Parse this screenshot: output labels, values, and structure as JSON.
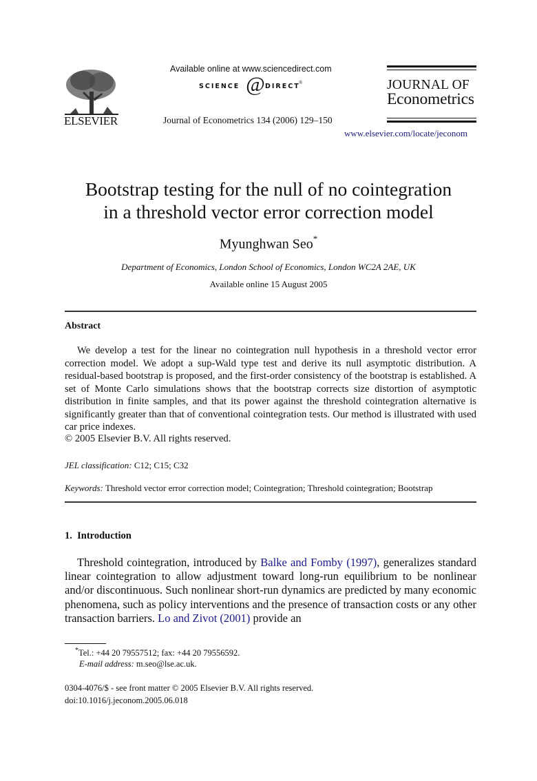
{
  "header": {
    "publisher_logo_text": "ELSEVIER",
    "available_online_text": "Available online at www.sciencedirect.com",
    "sciencedirect_left": "SCIENCE",
    "sciencedirect_at": "@",
    "sciencedirect_right": "DIRECT",
    "sciencedirect_mark": "®",
    "journal_reference": "Journal of Econometrics 134 (2006) 129–150",
    "journal_title_line1": "JOURNAL OF",
    "journal_title_line2": "Econometrics",
    "journal_url": "www.elsevier.com/locate/jeconom"
  },
  "article": {
    "title_line1": "Bootstrap testing for the null of no cointegration",
    "title_line2": "in a threshold vector error correction model",
    "author": "Myunghwan Seo",
    "author_mark": "*",
    "affiliation": "Department of Economics, London School of Economics, London WC2A 2AE, UK",
    "available_online": "Available online 15 August 2005"
  },
  "abstract": {
    "heading": "Abstract",
    "text": "We develop a test for the linear no cointegration null hypothesis in a threshold vector error correction model. We adopt a sup-Wald type test and derive its null asymptotic distribution. A residual-based bootstrap is proposed, and the first-order consistency of the bootstrap is established. A set of Monte Carlo simulations shows that the bootstrap corrects size distortion of asymptotic distribution in finite samples, and that its power against the threshold cointegration alternative is significantly greater than that of conventional cointegration tests. Our method is illustrated with used car price indexes.",
    "copyright": "© 2005 Elsevier B.V. All rights reserved.",
    "jel_label": "JEL classification:",
    "jel_codes": "C12; C15; C32",
    "keywords_label": "Keywords:",
    "keywords": "Threshold vector error correction model; Cointegration; Threshold cointegration; Bootstrap"
  },
  "introduction": {
    "heading": "1.  Introduction",
    "text_part1": "Threshold cointegration, introduced by ",
    "citation1": "Balke and Fomby (1997)",
    "text_part2": ", generalizes standard linear cointegration to allow adjustment toward long-run equilibrium to be nonlinear and/or discontinuous. Such nonlinear short-run dynamics are predicted by many economic phenomena, such as policy interventions and the presence of transaction costs or any other transaction barriers. ",
    "citation2": "Lo and Zivot (2001)",
    "text_part3": " provide an"
  },
  "footnotes": {
    "mark": "*",
    "contact": "Tel.: +44 20 79557512; fax: +44 20 79556592.",
    "email_label": "E-mail address:",
    "email": "m.seo@lse.ac.uk."
  },
  "front_matter": {
    "line1": "0304-4076/$ - see front matter © 2005 Elsevier B.V. All rights reserved.",
    "doi": "doi:10.1016/j.jeconom.2005.06.018"
  },
  "colors": {
    "link": "#1a1a8c",
    "text": "#111111"
  }
}
